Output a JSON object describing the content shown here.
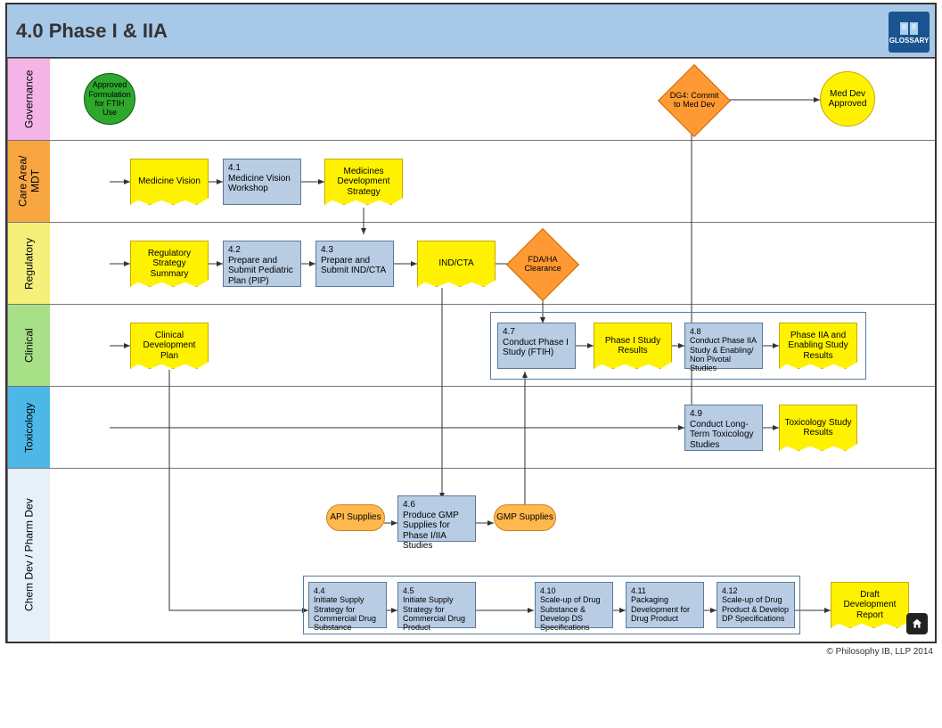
{
  "header": {
    "title": "4.0 Phase I & IIA",
    "glossary_label": "GLOSSARY"
  },
  "footer": {
    "copyright": "© Philosophy IB, LLP 2014"
  },
  "lanes": {
    "governance": "Governance",
    "care_area": "Care Area/\nMDT",
    "regulatory": "Regulatory",
    "clinical": "Clinical",
    "toxicology": "Toxicology",
    "chem_dev": "Chem Dev / Pharm Dev"
  },
  "nodes": {
    "approved_formulation": "Approved Formulation for FTIH Use",
    "dg4": "DG4: Commit to Med Dev",
    "med_dev_approved": "Med Dev Approved",
    "medicine_vision": "Medicine Vision",
    "n41": "4.1\nMedicine Vision Workshop",
    "medicines_dev_strategy": "Medicines Development Strategy",
    "reg_strategy_summary": "Regulatory Strategy Summary",
    "n42": "4.2\nPrepare and Submit Pediatric Plan (PIP)",
    "n43": "4.3\nPrepare and Submit IND/CTA",
    "ind_cta": "IND/CTA",
    "fda_ha": "FDA/HA Clearance",
    "clinical_dev_plan": "Clinical Development Plan",
    "n47": "4.7\nConduct Phase I Study (FTIH)",
    "phase1_results": "Phase I Study Results",
    "n48": "4.8\nConduct Phase IIA Study & Enabling/ Non Pivotal Studies",
    "phase2a_results": "Phase IIA and Enabling Study Results",
    "n49": "4.9\nConduct Long-Term Toxicology Studies",
    "tox_results": "Toxicology Study Results",
    "api_supplies": "API Supplies",
    "n46": "4.6\nProduce GMP Supplies for Phase I/IIA Studies",
    "gmp_supplies": "GMP Supplies",
    "n44": "4.4\nInitiate Supply Strategy for Commercial Drug Substance",
    "n45": "4.5\nInitiate Supply Strategy for Commercial Drug Product",
    "n410": "4.10\nScale-up of Drug Substance & Develop DS Specifications",
    "n411": "4.11\nPackaging Development for Drug Product",
    "n412": "4.12\nScale-up of Drug Product & Develop DP Specifications",
    "draft_dev_report": "Draft Development Report"
  }
}
